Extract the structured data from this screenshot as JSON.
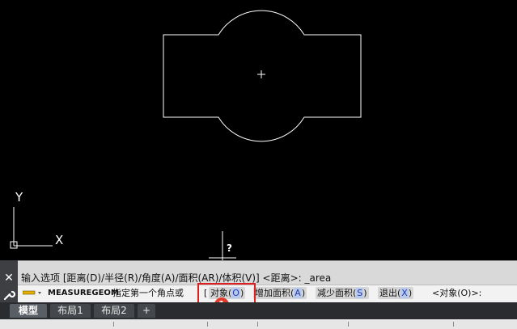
{
  "viewport": {
    "axis_y_label": "Y",
    "axis_x_label": "X",
    "cursor_tooltip": "?"
  },
  "command_history": {
    "text": "输入选项 [距离(D)/半径(R)/角度(A)/面积(AR)/体积(V)] <距离>: _area"
  },
  "command_line": {
    "command": "MEASUREGEOM",
    "prompt": "指定第一个角点或",
    "bracket_open": "[",
    "options": [
      {
        "label": "对象(",
        "key": "O",
        "close": ")"
      },
      {
        "label": "增加面积(",
        "key": "A",
        "close": ")"
      },
      {
        "label": "减少面积(",
        "key": "S",
        "close": ")"
      },
      {
        "label": "退出(",
        "key": "X",
        "close": ")"
      }
    ],
    "suffix": "<对象(O)>:"
  },
  "annotation": {
    "badge": "1"
  },
  "tabs": [
    {
      "label": "模型",
      "active": true
    },
    {
      "label": "布局1",
      "active": false
    },
    {
      "label": "布局2",
      "active": false
    },
    {
      "label": "+",
      "active": false
    }
  ],
  "colors": {
    "canvas": "#000000",
    "drawing": "#ffffff",
    "highlight": "#e02020",
    "option_key": "#1f3fb0"
  }
}
